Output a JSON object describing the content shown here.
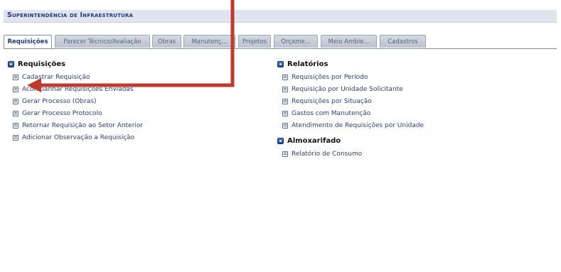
{
  "header": {
    "title": "Superintendência de Infraestrutura"
  },
  "tabs": [
    {
      "label": "Requisições",
      "active": true
    },
    {
      "label": "Parecer Técnico/Avaliação",
      "active": false
    },
    {
      "label": "Obras",
      "active": false
    },
    {
      "label": "Manutenç...",
      "active": false
    },
    {
      "label": "Projetos",
      "active": false
    },
    {
      "label": "Orçame...",
      "active": false
    },
    {
      "label": "Meio Ambie...",
      "active": false
    },
    {
      "label": "Cadastros",
      "active": false
    }
  ],
  "left": {
    "requisicoes": {
      "title": "Requisições",
      "items": [
        {
          "label": "Cadastrar Requisição"
        },
        {
          "label": "Acompanhar Requisições Enviadas"
        },
        {
          "label": "Gerar Processo (Obras)"
        },
        {
          "label": "Gerar Processo Protocolo"
        },
        {
          "label": "Retornar Requisição ao Setor Anterior"
        },
        {
          "label": "Adicionar Observação a Requisição"
        }
      ]
    }
  },
  "right": {
    "relatorios": {
      "title": "Relatórios",
      "items": [
        {
          "label": "Requisições por Período"
        },
        {
          "label": "Requisição por Unidade Solicitante"
        },
        {
          "label": "Requisições por Situação"
        },
        {
          "label": "Gastos com Manutenção"
        },
        {
          "label": "Atendimento de Requisições por Unidade"
        }
      ]
    },
    "almoxarifado": {
      "title": "Almoxarifado",
      "items": [
        {
          "label": "Relatório de Consumo"
        }
      ]
    }
  },
  "colors": {
    "annotation_arrow": "#c0392b",
    "header_bg": "#dfe4ee",
    "link": "#28407a"
  }
}
